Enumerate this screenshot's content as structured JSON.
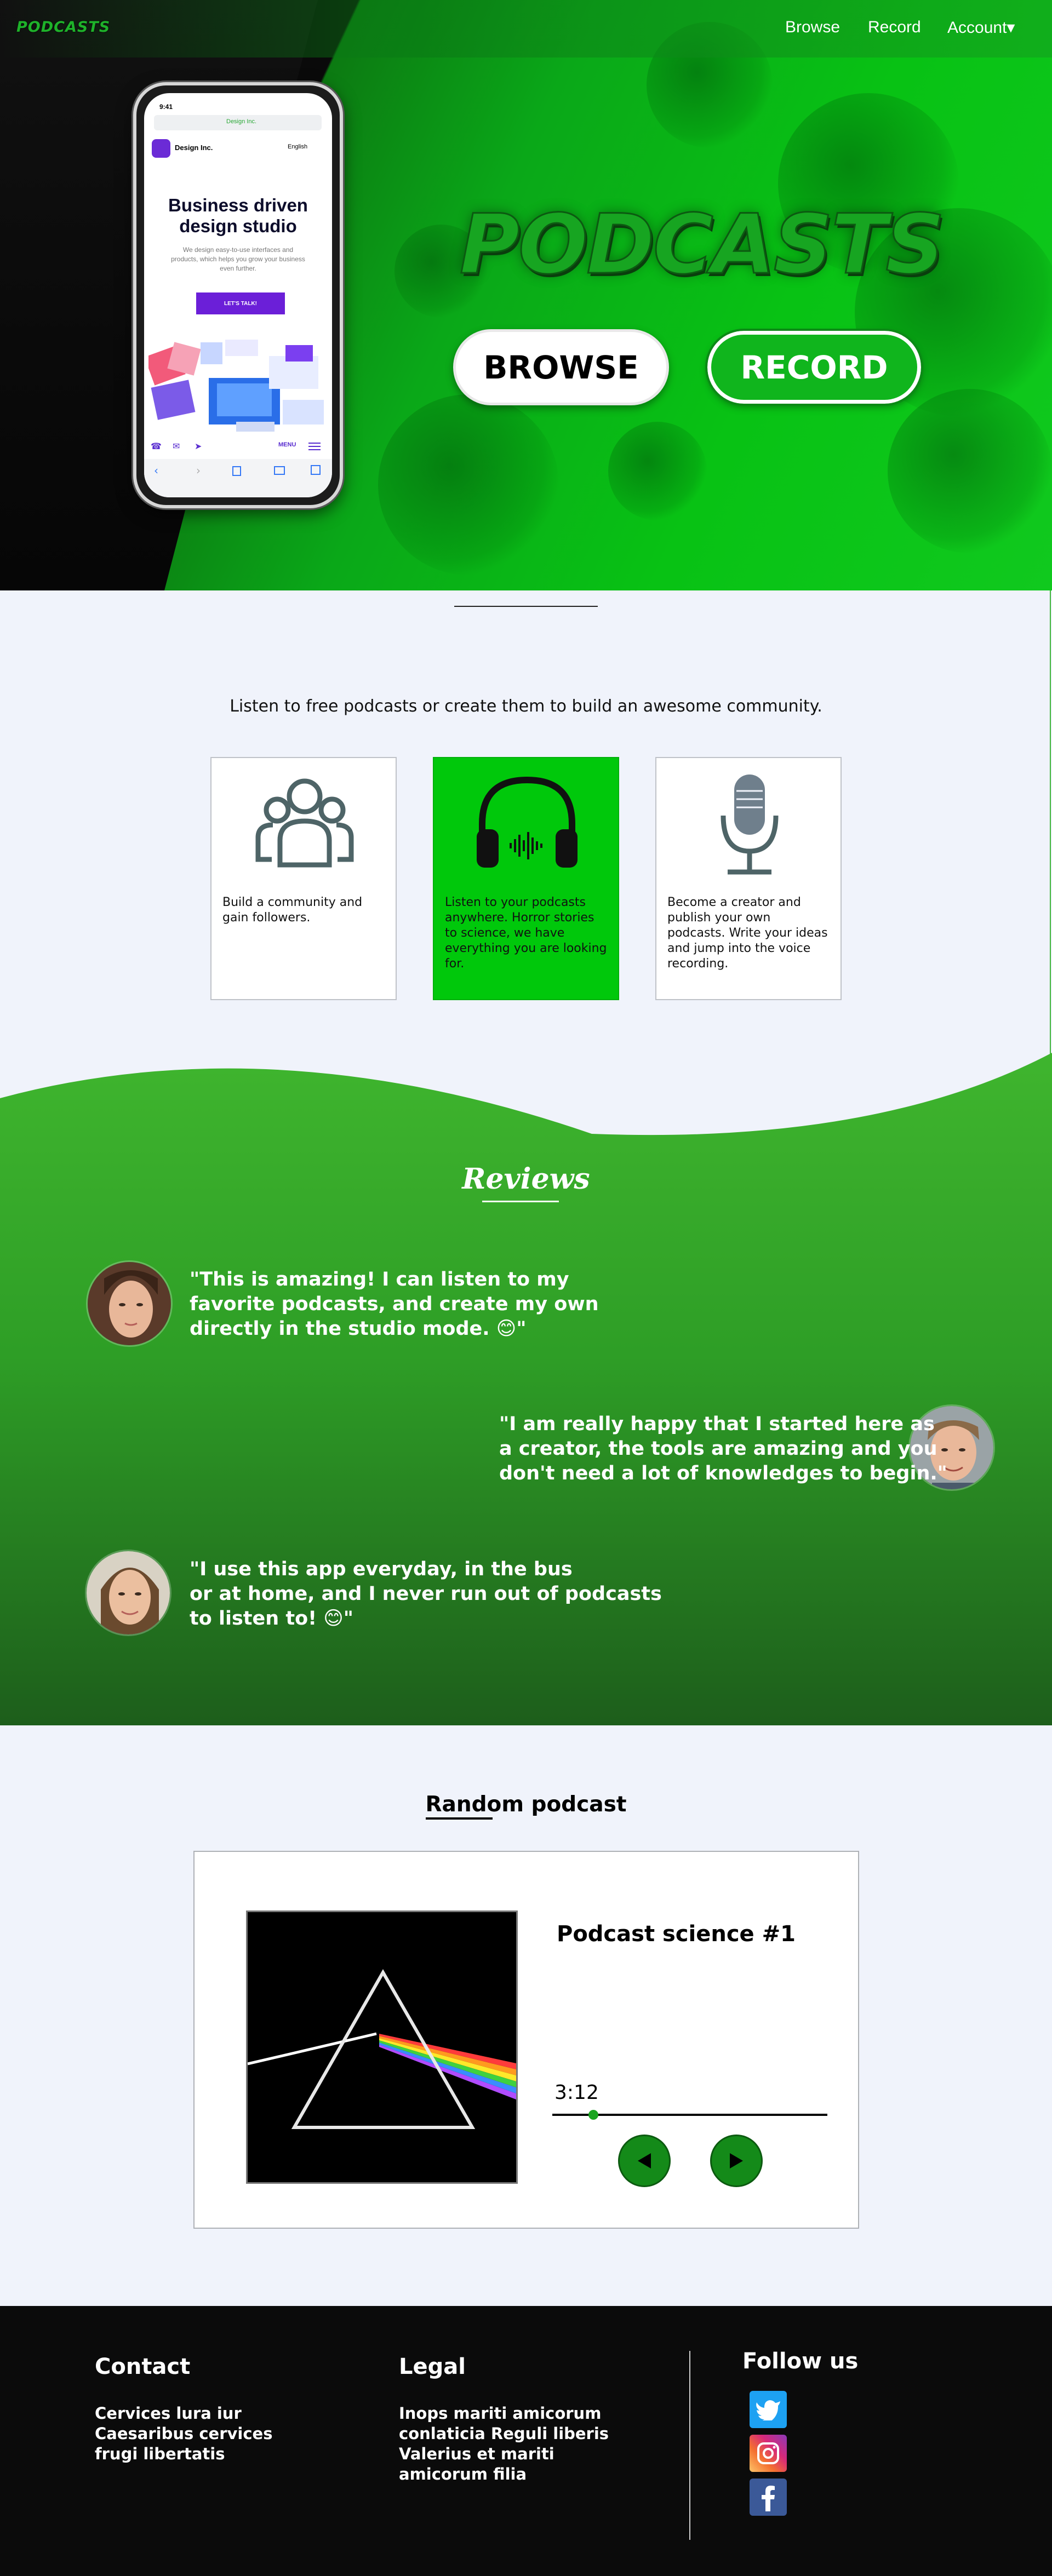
{
  "header": {
    "logo": "PODCASTS",
    "nav": [
      {
        "label": "Browse"
      },
      {
        "label": "Record"
      },
      {
        "label": "Account▾"
      }
    ]
  },
  "hero": {
    "title": "PODCASTS",
    "browse_label": "BROWSE",
    "record_label": "RECORD",
    "phone": {
      "time": "9:41",
      "url": "Design Inc.",
      "brand": "Design Inc.",
      "language": "English",
      "heading": "Business driven design studio",
      "body": "We design easy-to-use interfaces and products, which helps you grow your business even further.",
      "cta": "LET'S TALK!",
      "menu": "MENU"
    }
  },
  "intro": {
    "text": "Listen to free podcasts or create them to build an awesome community.",
    "cards": [
      {
        "icon": "community-icon",
        "text": "Build a community and gain followers.",
        "bg": "#ffffff"
      },
      {
        "icon": "headphones-icon",
        "text": "Listen to your podcasts anywhere. Horror stories to science, we have everything you are looking for.",
        "bg": "#00c80b"
      },
      {
        "icon": "microphone-icon",
        "text": "Become a creator and publish your own podcasts. Write your ideas and jump into the voice recording.",
        "bg": "#ffffff"
      }
    ]
  },
  "reviews": {
    "title": "Reviews",
    "items": [
      {
        "lines": [
          "\"This is amazing! I can listen to my",
          "favorite podcasts, and create my own",
          "directly in the studio mode. 😊\""
        ]
      },
      {
        "lines": [
          "\"I am really happy that I started here as",
          "a creator, the tools are amazing and you",
          "don't need a lot of knowledges to begin.\""
        ]
      },
      {
        "lines": [
          "\"I use this app everyday, in the bus",
          "or at home, and I never run out of podcasts",
          "to listen to! 😊\""
        ]
      }
    ]
  },
  "random": {
    "title": "Random podcast",
    "episode": "Podcast science #1",
    "time": "3:12",
    "progress": 0.15
  },
  "footer": {
    "contact_title": "Contact",
    "contact_lines": [
      "Cervices lura iur",
      "Caesaribus cervices",
      "frugi libertatis"
    ],
    "legal_title": "Legal",
    "legal_lines": [
      "Inops mariti amicorum",
      "conlaticia Reguli liberis",
      "Valerius et mariti",
      "amicorum filia"
    ],
    "follow_title": "Follow us",
    "social": [
      "twitter-icon",
      "instagram-icon",
      "facebook-icon"
    ]
  },
  "colors": {
    "accent": "#10b51d",
    "dark": "#0b0b0b",
    "page_bg": "#f0f3fb"
  }
}
